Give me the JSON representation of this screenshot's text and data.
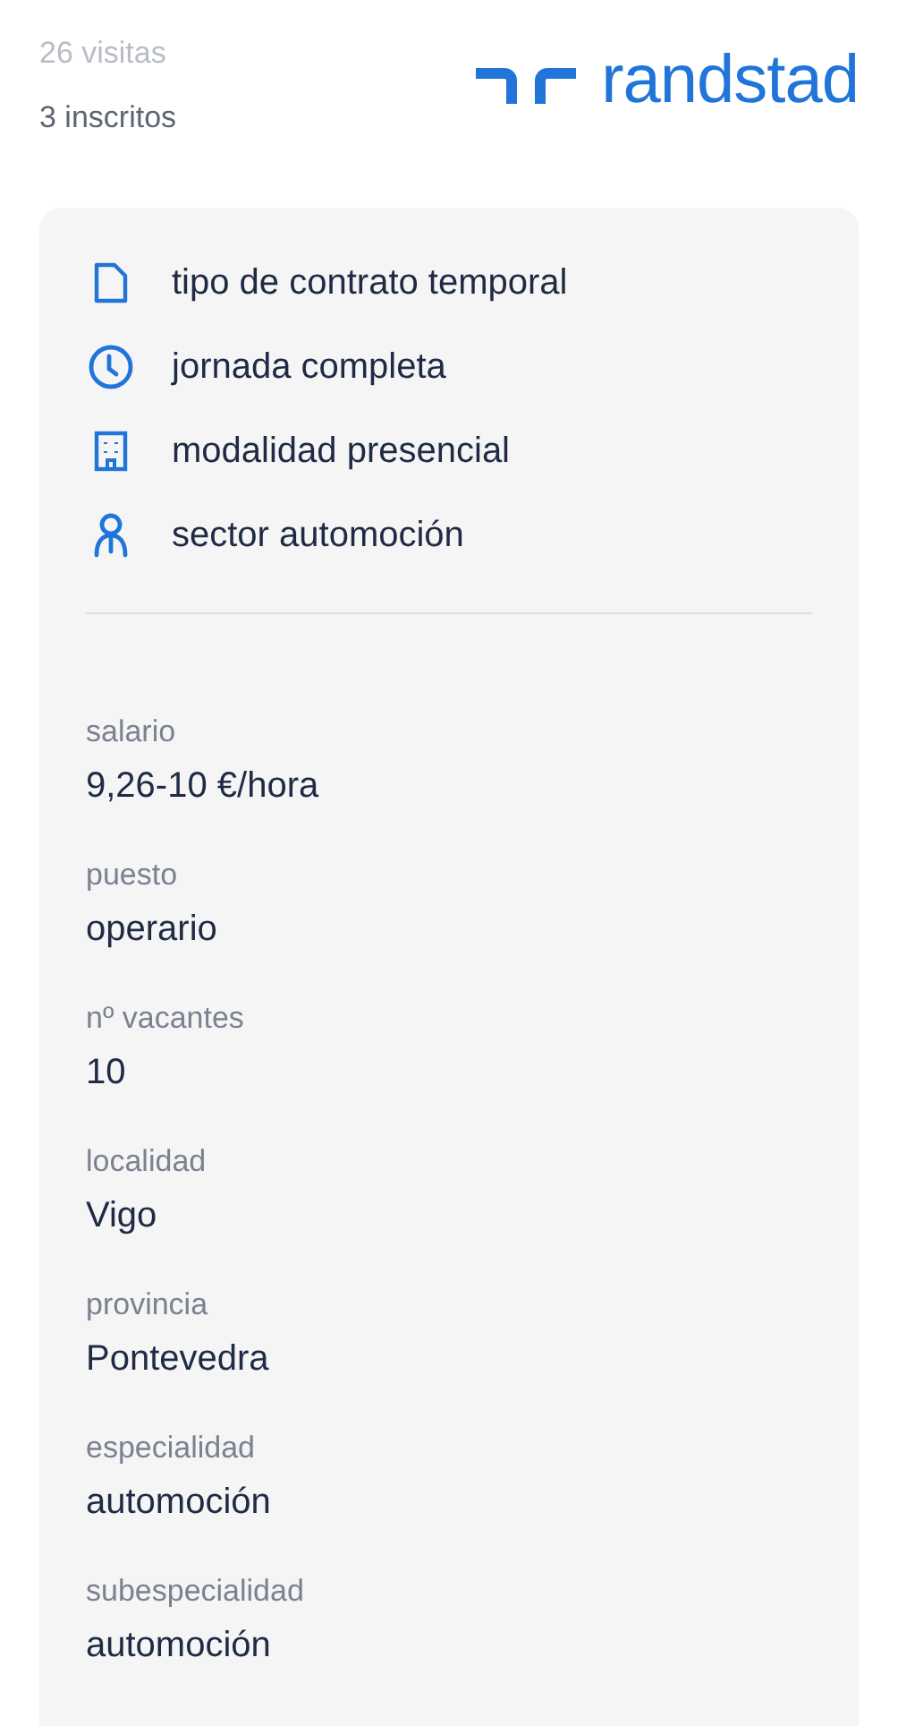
{
  "stats": [
    "26 visitas",
    "3 inscritos"
  ],
  "logo": {
    "text": "randstad"
  },
  "features": [
    {
      "kind": "document",
      "text": "tipo de contrato temporal"
    },
    {
      "kind": "clock",
      "text": "jornada completa"
    },
    {
      "kind": "building",
      "text": "modalidad presencial"
    },
    {
      "kind": "person",
      "text": "sector automoción"
    }
  ],
  "details": [
    {
      "label": "salario",
      "value": "9,26-10 €/hora"
    },
    {
      "label": "puesto",
      "value": "operario"
    },
    {
      "label": "nº vacantes",
      "value": "10"
    },
    {
      "label": "localidad",
      "value": "Vigo"
    },
    {
      "label": "provincia",
      "value": "Pontevedra"
    },
    {
      "label": "especialidad",
      "value": "automoción"
    },
    {
      "label": "subespecialidad",
      "value": "automoción"
    }
  ]
}
